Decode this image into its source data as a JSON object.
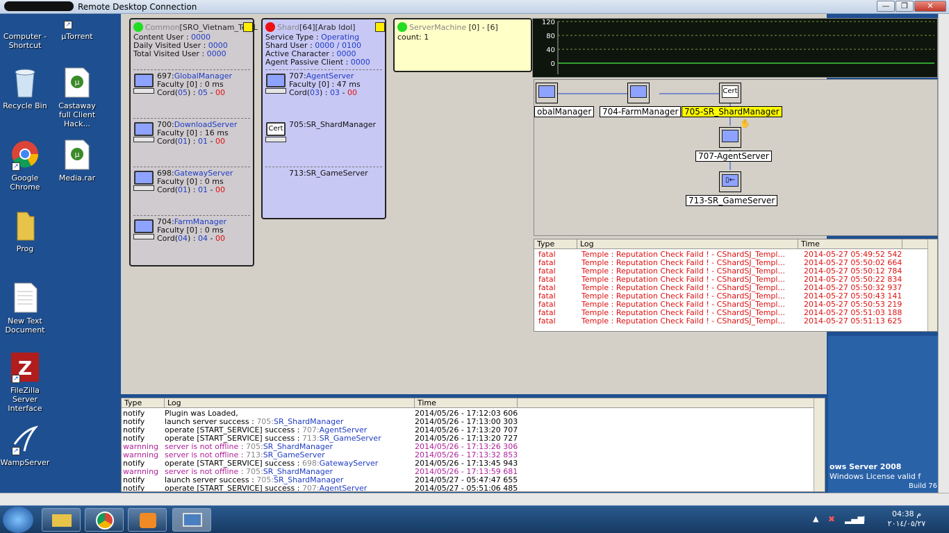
{
  "window": {
    "title": "Remote Desktop Connection",
    "min": "—",
    "restore": "❐",
    "close": "✕"
  },
  "desktop": [
    {
      "label": "Computer - Shortcut"
    },
    {
      "label": "µTorrent"
    },
    {
      "label": "Recycle Bin"
    },
    {
      "label": "Castaway full Client Hack..."
    },
    {
      "label": "Google Chrome"
    },
    {
      "label": "Media.rar"
    },
    {
      "label": "Prog"
    },
    {
      "label": "New Text Document"
    },
    {
      "label": "FileZilla Server Interface"
    },
    {
      "label": "WampServer"
    }
  ],
  "common": {
    "head_a": "Common",
    "head_b": "[SRO_Vietnam_TestL",
    "content_label": "Content User : ",
    "content_val": "0000",
    "daily_label": "Daily Visited User : ",
    "daily_val": "0000",
    "total_label": "Total Visited User : ",
    "total_val": "0000",
    "servers": [
      {
        "id": "697:",
        "name": "GlobalManager",
        "faculty": "Faculty [0] : 0 ms",
        "cord_a": "Cord(",
        "cord_b": "05",
        "cord_c": ") : ",
        "cord_d": "05",
        "cord_e": " - ",
        "cord_f": "00"
      },
      {
        "id": "700:",
        "name": "DownloadServer",
        "faculty": "Faculty [0] : 16 ms",
        "cord_a": "Cord(",
        "cord_b": "01",
        "cord_c": ") : ",
        "cord_d": "01",
        "cord_e": " - ",
        "cord_f": "00"
      },
      {
        "id": "698:",
        "name": "GatewayServer",
        "faculty": "Faculty [0] : 0 ms",
        "cord_a": "Cord(",
        "cord_b": "01",
        "cord_c": ") : ",
        "cord_d": "01",
        "cord_e": " - ",
        "cord_f": "00"
      },
      {
        "id": "704:",
        "name": "FarmManager",
        "faculty": "Faculty [0] : 0 ms",
        "cord_a": "Cord(",
        "cord_b": "04",
        "cord_c": ") : ",
        "cord_d": "04",
        "cord_e": " - ",
        "cord_f": "00"
      }
    ]
  },
  "shard": {
    "head_a": "Shard",
    "head_b": "[64][Arab Idol]",
    "stype_label": "Service Type : ",
    "stype_val": "Operating",
    "suser_label": "Shard User : ",
    "suser_val": "0000 / 0100",
    "achar_label": "Active Character : ",
    "achar_val": "0000",
    "apass_label": "Agent Passive Client : ",
    "apass_val": "0000",
    "agent": {
      "id": "707:",
      "name": "AgentServer",
      "faculty": "Faculty [0] : 47 ms",
      "cord_a": "Cord(",
      "cord_b": "03",
      "cord_c": ") : ",
      "cord_d": "03",
      "cord_e": " - ",
      "cord_f": "00"
    },
    "shardmgr": "705:SR_ShardManager",
    "cert": "Cert",
    "gameserver": "713:SR_GameServer"
  },
  "machine": {
    "head_a": "ServerMachine",
    "head_b": " [0] - [6]",
    "count": "count: 1"
  },
  "chart_data": {
    "type": "line",
    "yticks": [
      "120",
      "80",
      "40",
      "0"
    ],
    "ylim": [
      0,
      120
    ],
    "series": [
      {
        "values": [
          0,
          0,
          0,
          0,
          0,
          0,
          0,
          0,
          0,
          0,
          0
        ]
      }
    ],
    "grid": true
  },
  "topo": {
    "global": "obalManager",
    "farm": "704-FarmManager",
    "shard": "705-SR_ShardManager",
    "agent": "707-AgentServer",
    "game": "713-SR_GameServer",
    "cert": "Cert"
  },
  "log1": {
    "cols": [
      "Type",
      "Log",
      "Time"
    ],
    "rows": [
      {
        "type": "fatal",
        "log": "Temple : Reputation Check Faild ! - CShardSJ_Templ...",
        "time": "2014-05-27 05:49:52 542"
      },
      {
        "type": "fatal",
        "log": "Temple : Reputation Check Faild ! - CShardSJ_Templ...",
        "time": "2014-05-27 05:50:02 664"
      },
      {
        "type": "fatal",
        "log": "Temple : Reputation Check Faild ! - CShardSJ_Templ...",
        "time": "2014-05-27 05:50:12 784"
      },
      {
        "type": "fatal",
        "log": "Temple : Reputation Check Faild ! - CShardSJ_Templ...",
        "time": "2014-05-27 05:50:22 834"
      },
      {
        "type": "fatal",
        "log": "Temple : Reputation Check Faild ! - CShardSJ_Templ...",
        "time": "2014-05-27 05:50:32 937"
      },
      {
        "type": "fatal",
        "log": "Temple : Reputation Check Faild ! - CShardSJ_Templ...",
        "time": "2014-05-27 05:50:43 141"
      },
      {
        "type": "fatal",
        "log": "Temple : Reputation Check Faild ! - CShardSJ_Templ...",
        "time": "2014-05-27 05:50:53 219"
      },
      {
        "type": "fatal",
        "log": "Temple : Reputation Check Faild ! - CShardSJ_Templ...",
        "time": "2014-05-27 05:51:03 188"
      },
      {
        "type": "fatal",
        "log": "Temple : Reputation Check Faild ! - CShardSJ_Templ...",
        "time": "2014-05-27 05:51:13 625"
      }
    ]
  },
  "log2": {
    "cols": [
      "Type",
      "Log",
      "Time"
    ],
    "rows": [
      {
        "type": "notify",
        "pre": "Plugin was Loaded,",
        "id": "",
        "name": "",
        "time": "2014/05/26 - 17:12:03 606"
      },
      {
        "type": "notify",
        "pre": "launch server success : ",
        "id": "705:",
        "name": "SR_ShardManager",
        "time": "2014/05/26 - 17:13:00 303"
      },
      {
        "type": "notify",
        "pre": "operate [START_SERVICE] success : ",
        "id": "707:",
        "name": "AgentServer",
        "time": "2014/05/26 - 17:13:20 707"
      },
      {
        "type": "notify",
        "pre": "operate [START_SERVICE] success : ",
        "id": "713:",
        "name": "SR_GameServer",
        "time": "2014/05/26 - 17:13:20 727"
      },
      {
        "type": "warnning",
        "pre": "server is not offline : ",
        "id": "705:",
        "name": "SR_ShardManager",
        "time": "2014/05/26 - 17:13:26 306"
      },
      {
        "type": "warnning",
        "pre": "server is not offline : ",
        "id": "713:",
        "name": "SR_GameServer",
        "time": "2014/05/26 - 17:13:32 853"
      },
      {
        "type": "notify",
        "pre": "operate [START_SERVICE] success : ",
        "id": "698:",
        "name": "GatewayServer",
        "time": "2014/05/26 - 17:13:45 943"
      },
      {
        "type": "warnning",
        "pre": "server is not offline : ",
        "id": "705:",
        "name": "SR_ShardManager",
        "time": "2014/05/26 - 17:13:59 681"
      },
      {
        "type": "notify",
        "pre": "launch server success : ",
        "id": "705:",
        "name": "SR_ShardManager",
        "time": "2014/05/27 - 05:47:47 655"
      },
      {
        "type": "notify",
        "pre": "operate [START_SERVICE] success : ",
        "id": "707:",
        "name": "AgentServer",
        "time": "2014/05/27 - 05:51:06 485"
      }
    ]
  },
  "bg": {
    "line1": "ows Server 2008 ",
    "line2": "Windows License valid f",
    "line3": "Build 76"
  },
  "clock": {
    "time": "04:38 م",
    "date": "٢٠١٤/٠٥/٢٧"
  },
  "colors": {
    "fatal": "#d11",
    "warn": "#b0209a",
    "notify": "#000",
    "blue": "#1f3cc4"
  }
}
